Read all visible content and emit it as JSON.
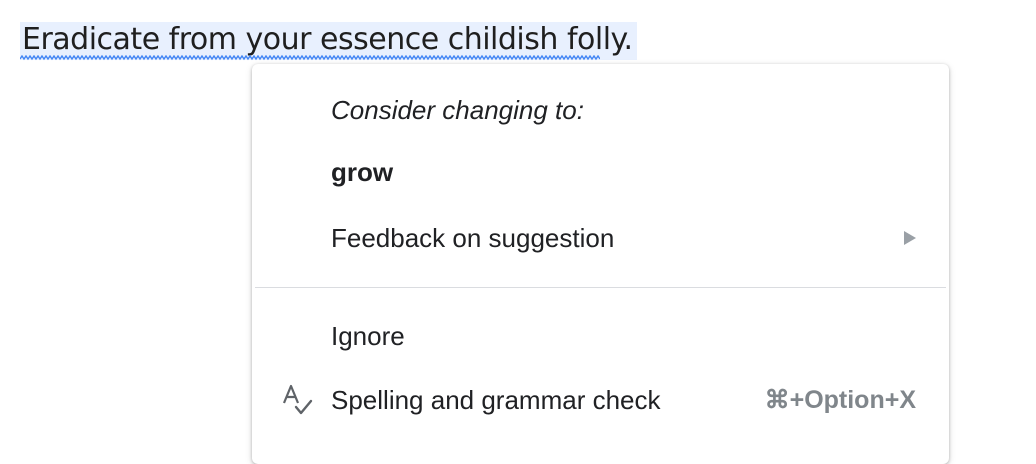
{
  "document": {
    "sentence": "Eradicate from your essence childish folly."
  },
  "context_menu": {
    "heading": "Consider changing to:",
    "suggestion": "grow",
    "feedback_label": "Feedback on suggestion",
    "ignore_label": "Ignore",
    "spellcheck_label": "Spelling and grammar check",
    "spellcheck_shortcut": "⌘+Option+X",
    "spellcheck_icon": "spellcheck-icon",
    "submenu_icon": "submenu-arrow-icon"
  },
  "colors": {
    "selection_highlight": "#e8f0fe",
    "squiggle": "#4285f4"
  }
}
